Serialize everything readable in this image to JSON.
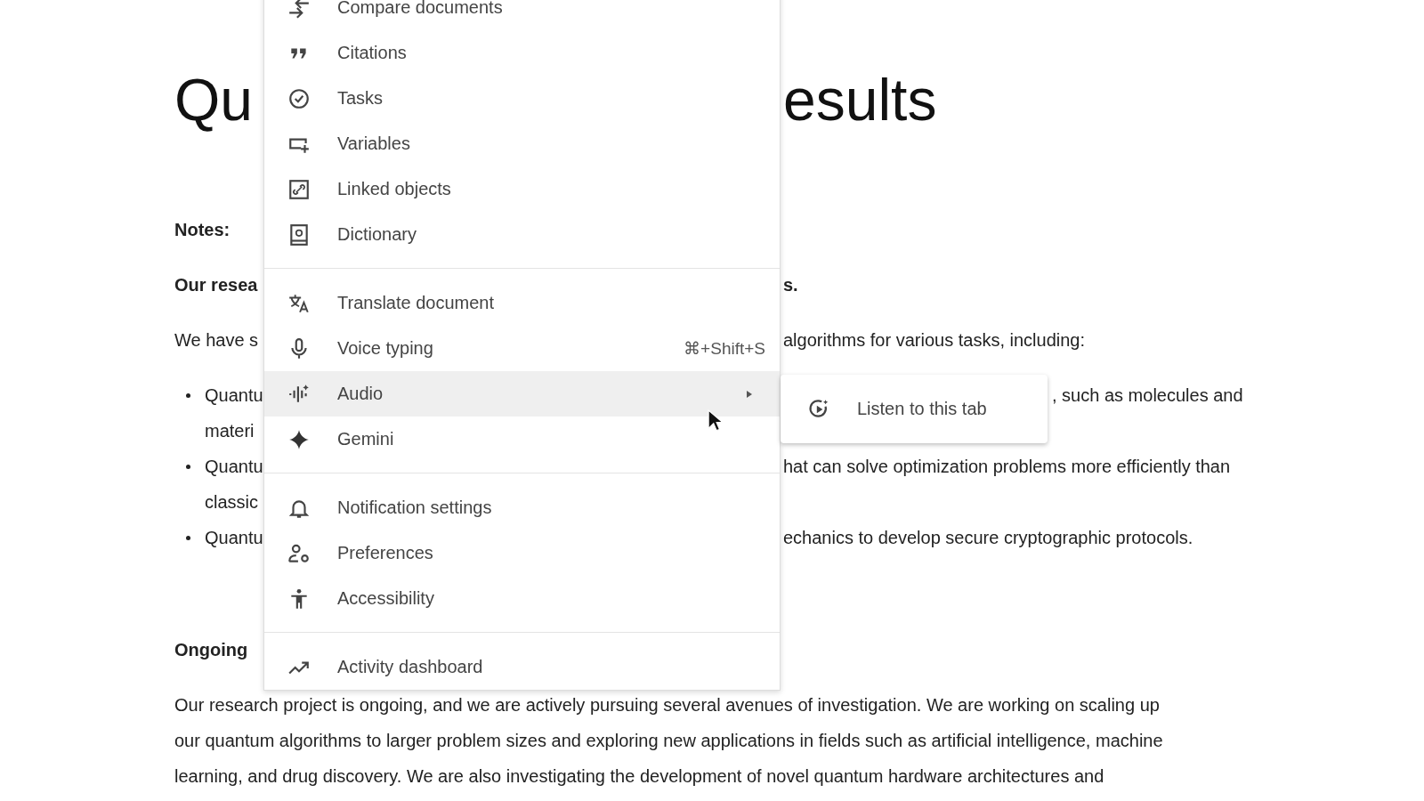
{
  "document": {
    "title": {
      "left": "Qu",
      "right": "esults"
    },
    "lines": [
      {
        "kind": "heading",
        "left": "Notes:"
      },
      {
        "kind": "bold",
        "left": "Our resea",
        "right": "s."
      },
      {
        "kind": "text",
        "left": "We have s",
        "right": "algorithms for various tasks, including:"
      },
      {
        "kind": "bullet",
        "left": "Quantu",
        "right": ", such as molecules and"
      },
      {
        "kind": "continuation",
        "left": "materi"
      },
      {
        "kind": "bullet",
        "left": "Quantu",
        "right": "hat can solve optimization problems more efficiently than"
      },
      {
        "kind": "continuation",
        "left": "classic"
      },
      {
        "kind": "bullet",
        "left": "Quantu",
        "right": "echanics to develop secure cryptographic protocols."
      },
      {
        "kind": "heading",
        "left": "Ongoing"
      }
    ],
    "paragraph": [
      "Our research project is ongoing, and we are actively pursuing several avenues of investigation. We are working on scaling up",
      "our quantum algorithms to larger problem sizes and exploring new applications in fields such as artificial intelligence, machine",
      "learning, and drug discovery. We are also investigating the development of novel quantum hardware architectures and"
    ]
  },
  "menu": {
    "groups": [
      {
        "items": [
          {
            "label": "Compare documents",
            "selected": false
          },
          {
            "label": "Citations",
            "selected": false
          },
          {
            "label": "Tasks",
            "selected": false
          },
          {
            "label": "Variables",
            "selected": false
          },
          {
            "label": "Linked objects",
            "selected": false
          },
          {
            "label": "Dictionary",
            "selected": false
          }
        ]
      },
      {
        "items": [
          {
            "label": "Translate document",
            "selected": false
          },
          {
            "label": "Voice typing",
            "shortcut": "⌘+Shift+S",
            "selected": false
          },
          {
            "label": "Audio",
            "submenu": true,
            "selected": true
          },
          {
            "label": "Gemini",
            "selected": false
          }
        ]
      },
      {
        "items": [
          {
            "label": "Notification settings",
            "selected": false
          },
          {
            "label": "Preferences",
            "selected": false
          },
          {
            "label": "Accessibility",
            "selected": false
          }
        ]
      },
      {
        "items": [
          {
            "label": "Activity dashboard",
            "selected": false
          }
        ]
      }
    ]
  },
  "submenu": {
    "items": [
      {
        "label": "Listen to this tab",
        "selected": false
      }
    ]
  }
}
